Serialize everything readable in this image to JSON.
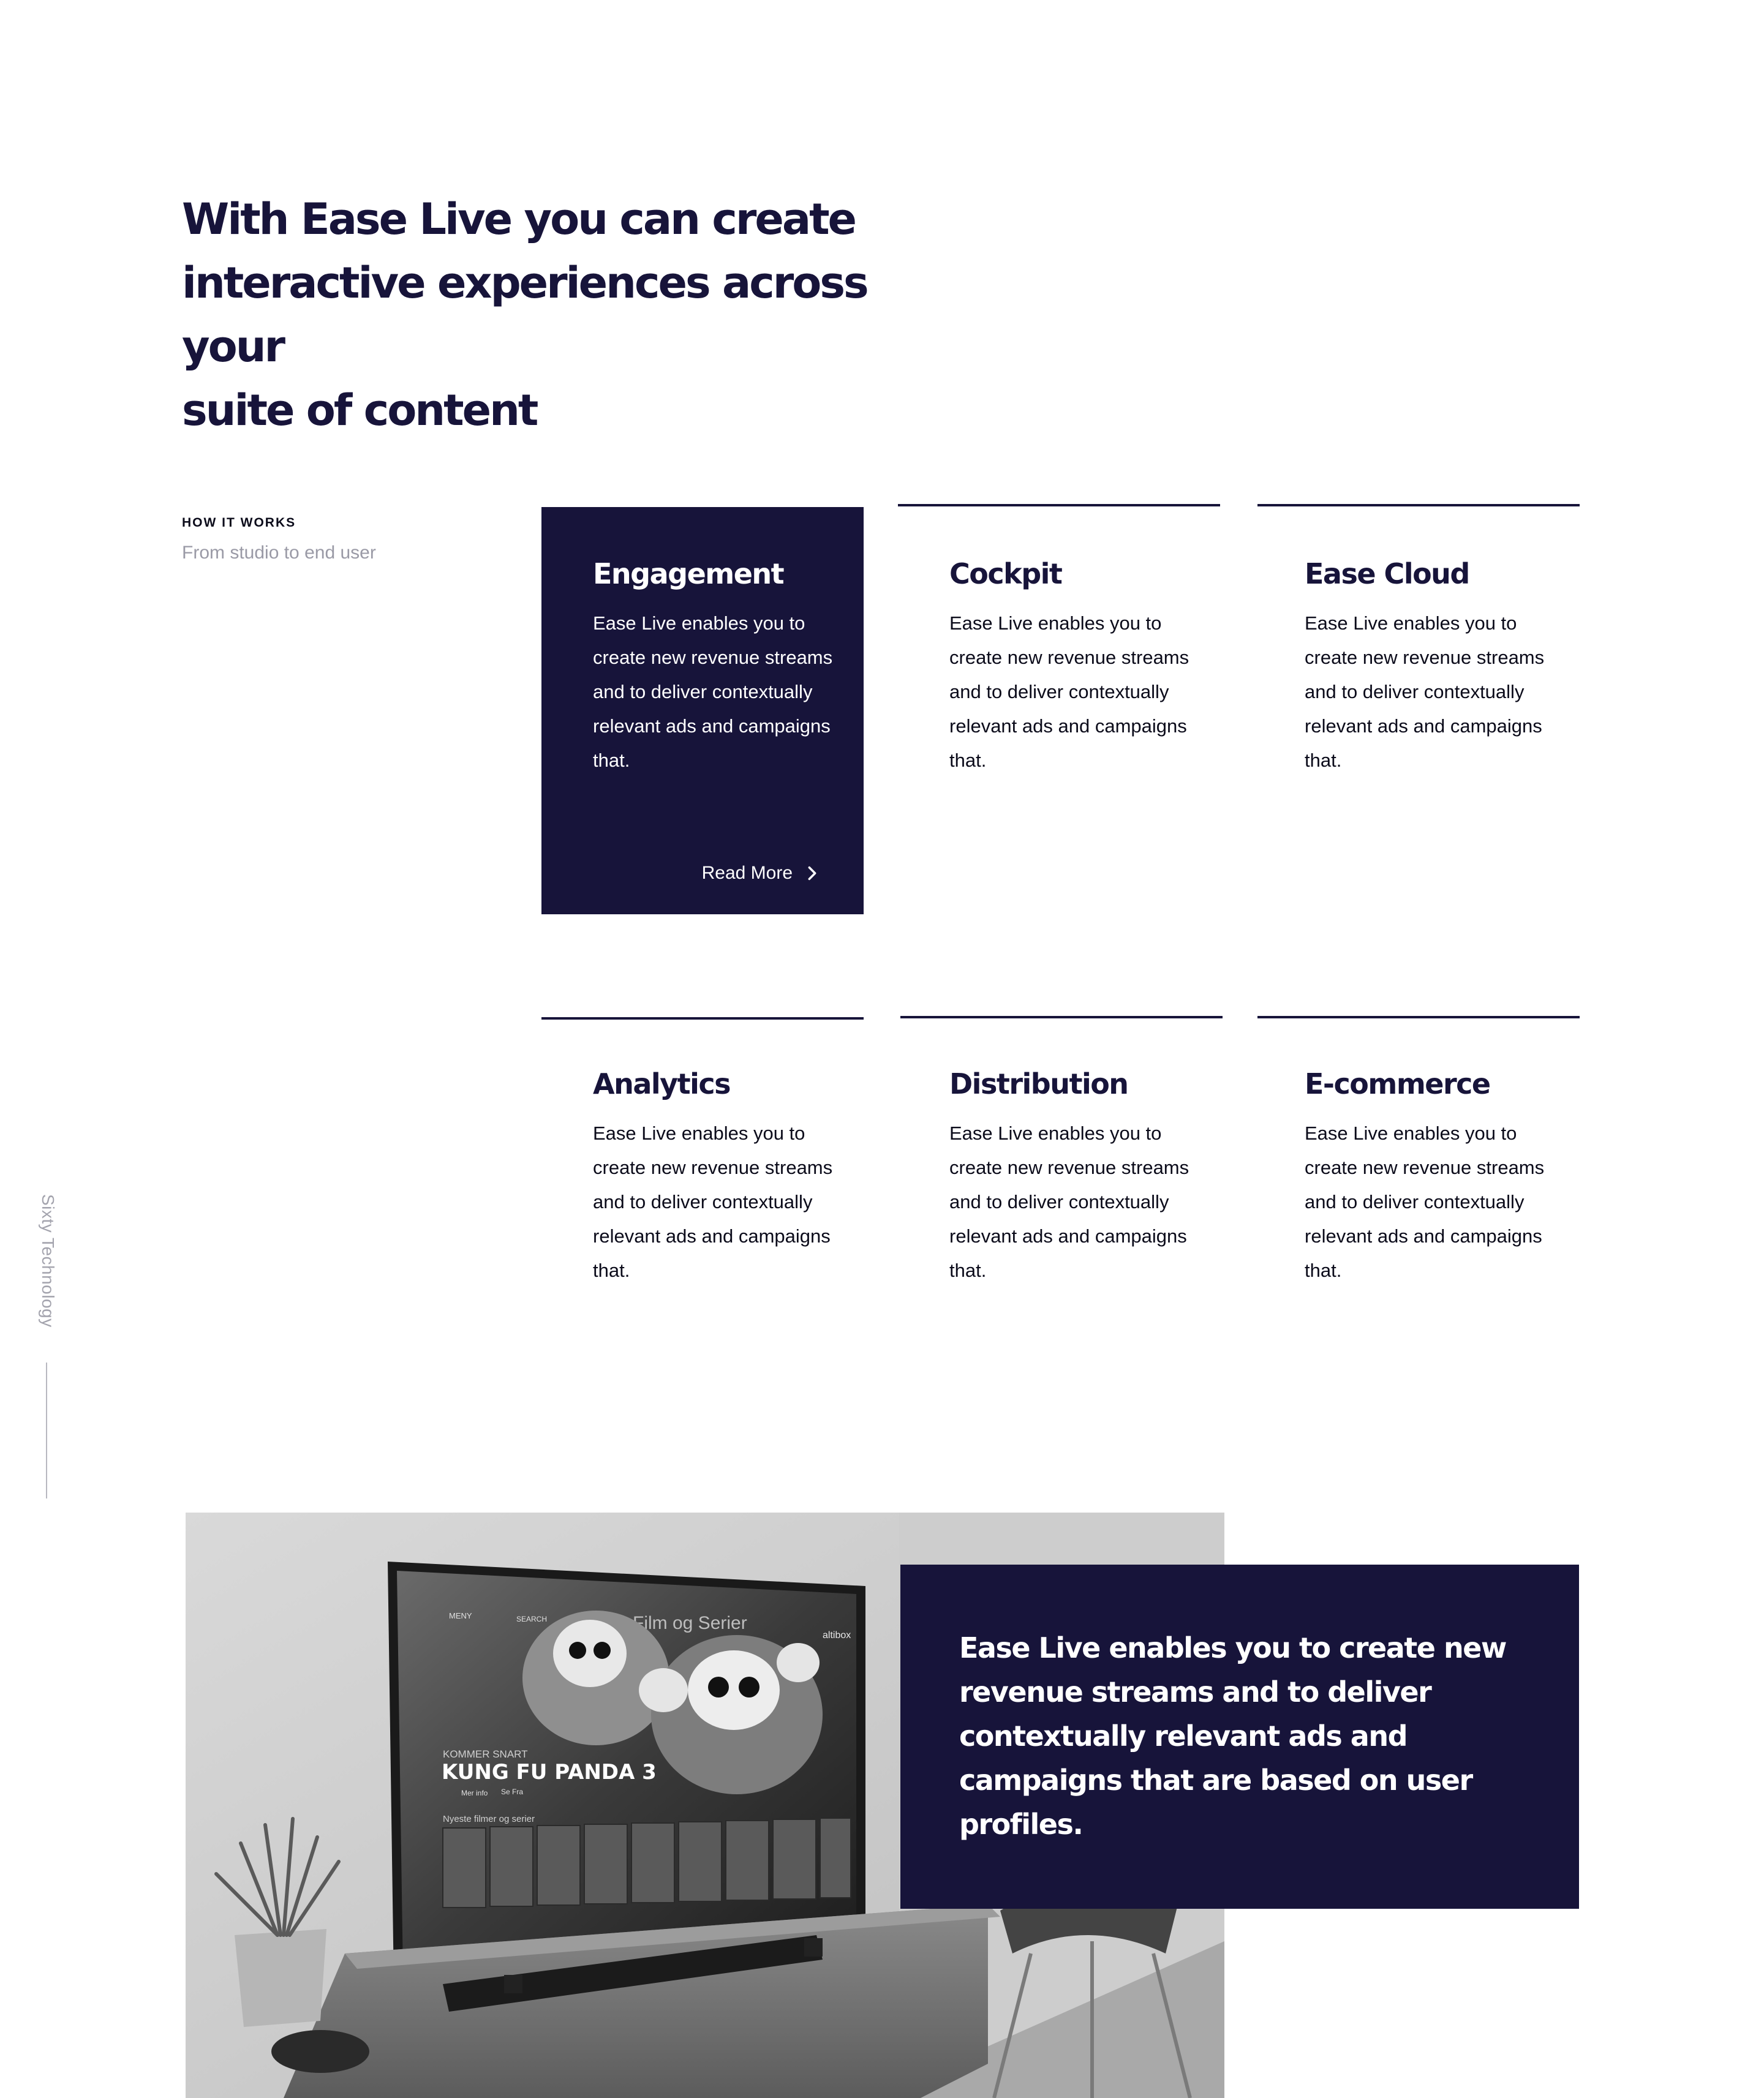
{
  "hero": {
    "title_line1": "With Ease Live you can create",
    "title_line2": "interactive experiences across your",
    "title_line3": "suite of content"
  },
  "section": {
    "eyebrow": "HOW IT WORKS",
    "subtitle": "From studio to end user"
  },
  "side_brand": "Sixty Technology",
  "cards": [
    {
      "title": "Engagement",
      "text": "Ease Live enables you to create new revenue streams and to deliver contextually relevant ads and campaigns that.",
      "cta": "Read More",
      "active": true
    },
    {
      "title": "Cockpit",
      "text": "Ease Live enables you to create new revenue streams and to deliver contextually relevant ads and campaigns that."
    },
    {
      "title": "Ease Cloud",
      "text": "Ease Live enables you to create new revenue streams and to deliver contextually relevant ads and campaigns that."
    },
    {
      "title": "Analytics",
      "text": "Ease Live enables you to create new revenue streams and to deliver contextually relevant ads and campaigns that."
    },
    {
      "title": "Distribution",
      "text": "Ease Live enables you to create new revenue streams and to deliver contextually relevant ads and campaigns that."
    },
    {
      "title": "E-commerce",
      "text": "Ease Live enables you to create new revenue streams and to deliver contextually relevant ads and campaigns that."
    }
  ],
  "photo": {
    "tv_menu": "MENY",
    "tv_search": "SEARCH",
    "tv_heading": "Film og Serier",
    "tv_brand": "altibox",
    "tv_kicker": "KOMMER SNART",
    "tv_title": "KUNG FU PANDA 3",
    "tv_btn1": "Mer info",
    "tv_btn2": "Se Fra",
    "tv_row_label": "Nyeste filmer og serier"
  },
  "quote": {
    "text": "Ease Live enables you to create new revenue streams and to deliver contextually relevant ads and campaigns that are based on user profiles."
  },
  "colors": {
    "navy": "#17143a",
    "muted": "#9a9aa6"
  }
}
